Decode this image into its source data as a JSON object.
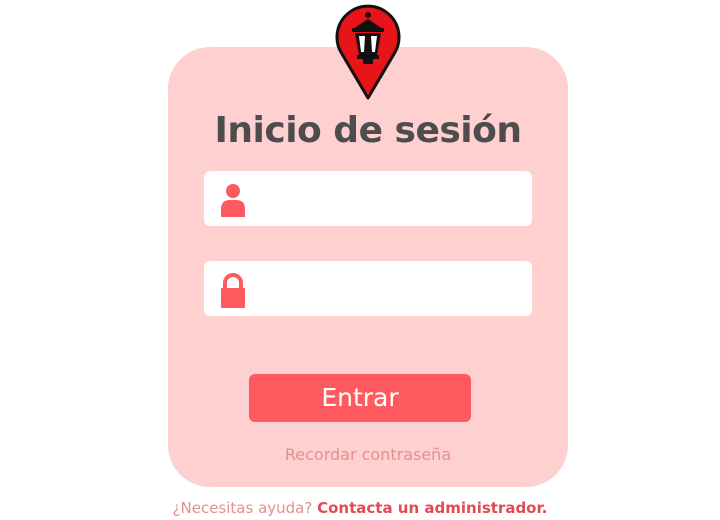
{
  "login": {
    "title": "Inicio de sesión",
    "username_field": {
      "value": "",
      "placeholder": "",
      "icon": "user-icon"
    },
    "password_field": {
      "value": "",
      "placeholder": "",
      "icon": "lock-icon"
    },
    "submit_label": "Entrar",
    "remember_label": "Recordar contraseña"
  },
  "help": {
    "question": "¿Necesitas ayuda?",
    "contact_label": "Contacta un administrador."
  },
  "logo": {
    "icon": "lantern-map-pin-icon"
  },
  "colors": {
    "card_background": "#ffd0d0",
    "accent": "#ff5a5f",
    "title_text": "#4d4d4d",
    "link_text": "#e58f8f",
    "contact_text": "#e04c51",
    "pin_red": "#e8141a"
  }
}
